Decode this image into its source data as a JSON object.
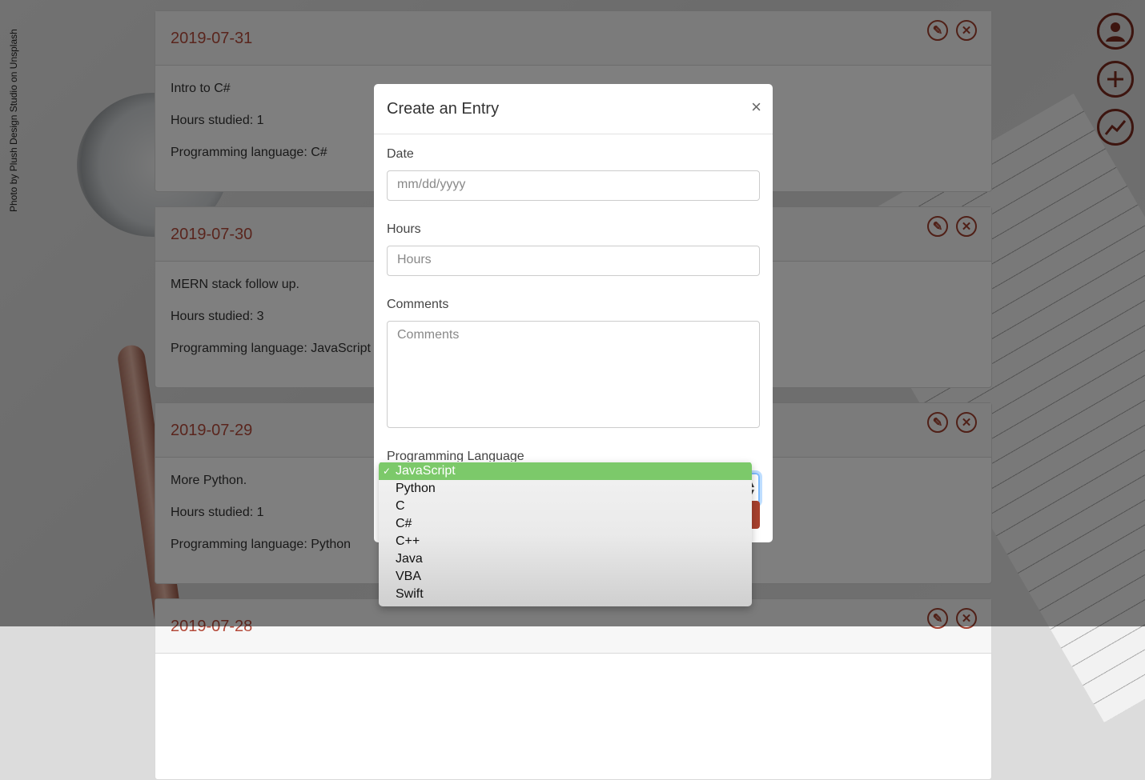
{
  "credit": "Photo by Plush Design Studio on Unsplash",
  "entries": [
    {
      "date": "2019-07-31",
      "comment": "Intro to C#",
      "hours": "Hours studied: 1",
      "language": "Programming language: C#"
    },
    {
      "date": "2019-07-30",
      "comment": "MERN stack follow up.",
      "hours": "Hours studied: 3",
      "language": "Programming language: JavaScript"
    },
    {
      "date": "2019-07-29",
      "comment": "More Python.",
      "hours": "Hours studied: 1",
      "language": "Programming language: Python"
    },
    {
      "date": "2019-07-28"
    }
  ],
  "modal": {
    "title": "Create an Entry",
    "close": "×",
    "date_label": "Date",
    "date_placeholder": "mm/dd/yyyy",
    "hours_label": "Hours",
    "hours_placeholder": "Hours",
    "comments_label": "Comments",
    "comments_placeholder": "Comments",
    "language_label": "Programming Language",
    "language_selected": "JavaScript"
  },
  "dropdown": {
    "check": "✓",
    "options": [
      "JavaScript",
      "Python",
      "C",
      "C#",
      "C++",
      "Java",
      "VBA",
      "Swift"
    ]
  },
  "sidebar_icons": [
    "user-icon",
    "plus-icon",
    "chart-icon"
  ]
}
